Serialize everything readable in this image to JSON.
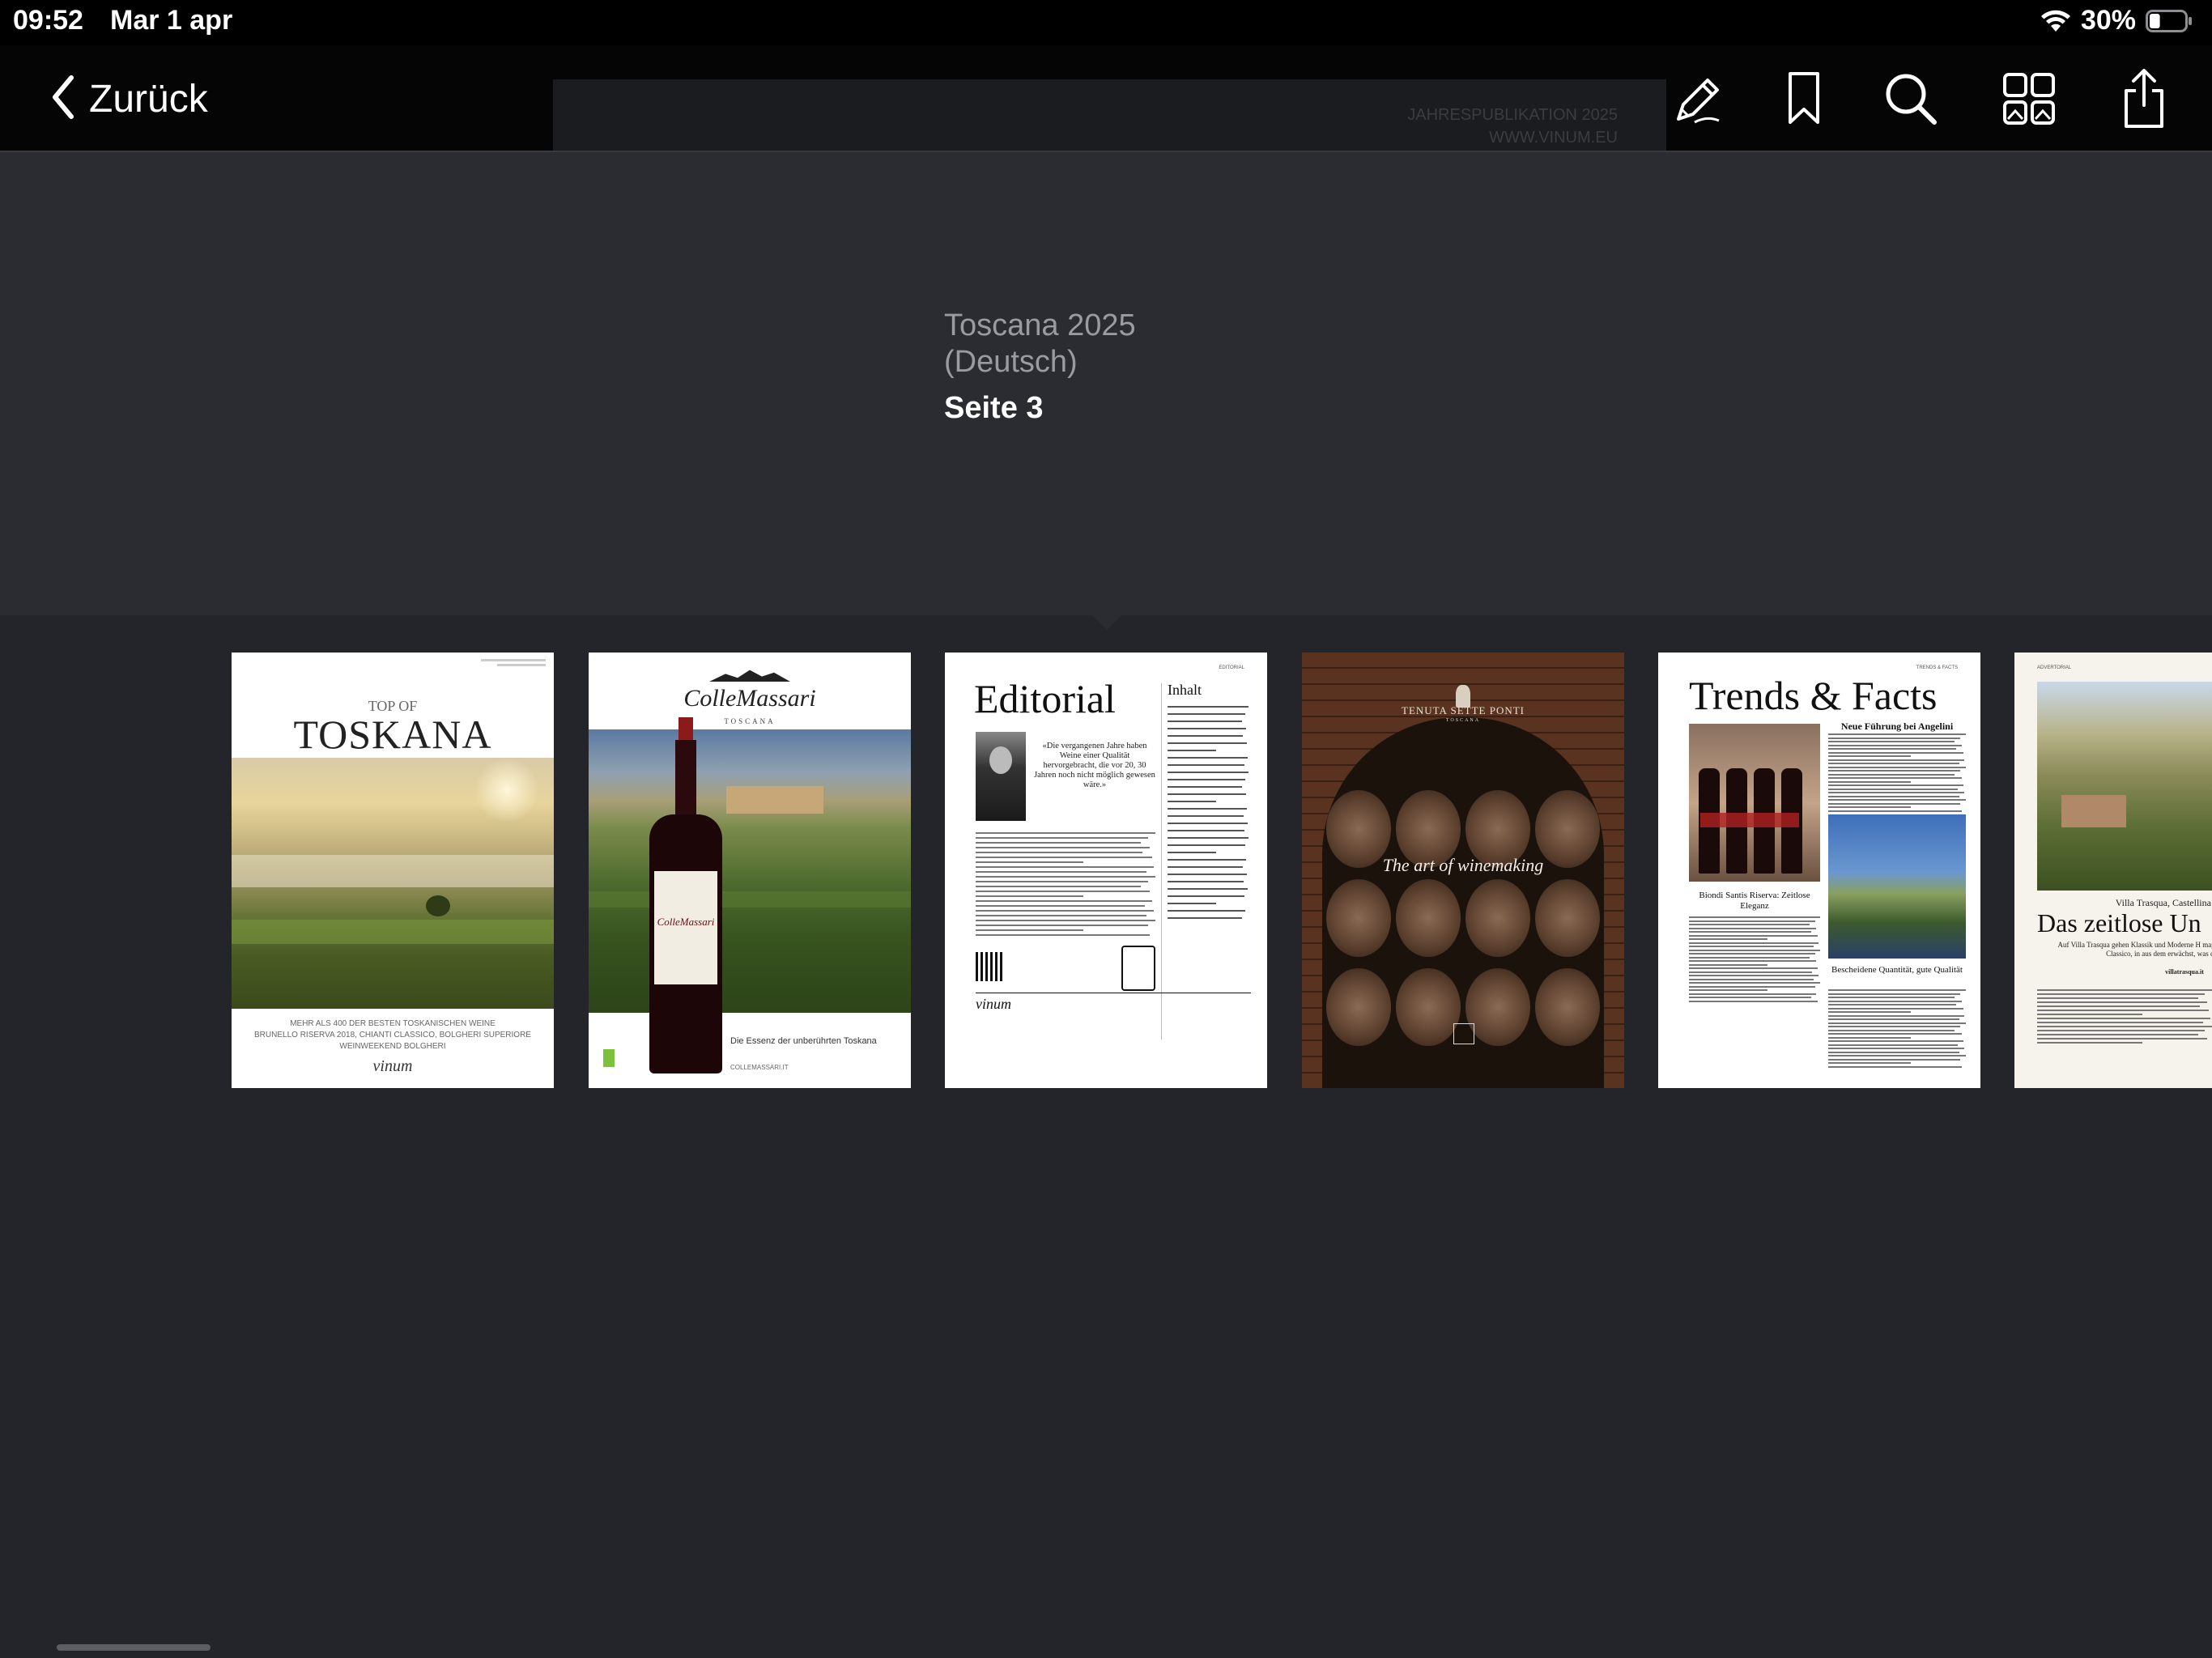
{
  "status_bar": {
    "time": "09:52",
    "date": "Mar 1 apr",
    "battery": "30%",
    "battery_level": 0.3
  },
  "toolbar": {
    "back_label": "Zurück",
    "peek_line1": "JAHRESPUBLIKATION 2025",
    "peek_line2": "WWW.VINUM.EU",
    "icons": [
      "markup-pen-icon",
      "bookmark-icon",
      "search-icon",
      "thumbnails-grid-icon",
      "share-icon"
    ]
  },
  "document": {
    "title": "Toscana 2025 (Deutsch)",
    "page_label": "Seite 3"
  },
  "thumbnails": [
    {
      "name": "cover",
      "kicker": "TOP OF",
      "title": "TOSKANA",
      "caption_line1": "MEHR ALS 400 DER BESTEN TOSKANISCHEN WEINE",
      "caption_line2": "BRUNELLO RISERVA 2018, CHIANTI CLASSICO, BOLGHERI SUPERIORE",
      "caption_line3": "WEINWEEKEND BOLGHERI",
      "signature": "vinum"
    },
    {
      "name": "collemassari-ad",
      "brand": "ColleMassari",
      "brand_sub": "TOSCANA",
      "label_brand": "ColleMassari",
      "tagline": "Die Essenz der unberührten Toskana",
      "url": "COLLEMASSARI.IT"
    },
    {
      "name": "editorial",
      "heading": "Editorial",
      "toc_heading": "Inhalt",
      "section_tag": "EDITORIAL",
      "quote": "«Die vergangenen Jahre haben Weine einer Qualität hervorgebracht, die vor 20, 30 Jahren noch nicht möglich gewesen wäre.»",
      "signature": "vinum"
    },
    {
      "name": "tenuta-sette-ponti-ad",
      "brand": "TENUTA SETTE PONTI",
      "brand_sub": "TOSCANA",
      "tagline": "The art of winemaking"
    },
    {
      "name": "trends-facts",
      "heading": "Trends & Facts",
      "section_tag": "TRENDS & FACTS",
      "subhead": "Neue Führung bei Angelini",
      "caption1": "Biondi Santis Riserva: Zeitlose Eleganz",
      "caption2": "Bescheidene Quantität, gute Qualität"
    },
    {
      "name": "villa-trasqua",
      "section_tag": "ADVERTORIAL",
      "kicker": "Villa Trasqua, Castellina in",
      "heading": "Das zeitlose Un",
      "sub": "Auf Villa Trasqua gehen Klassik und Moderne H magischer Ort im Herzen des Chianti Classico, in aus dem erwächst, was die Vergangenheit",
      "url": "villatrasqua.it"
    }
  ]
}
